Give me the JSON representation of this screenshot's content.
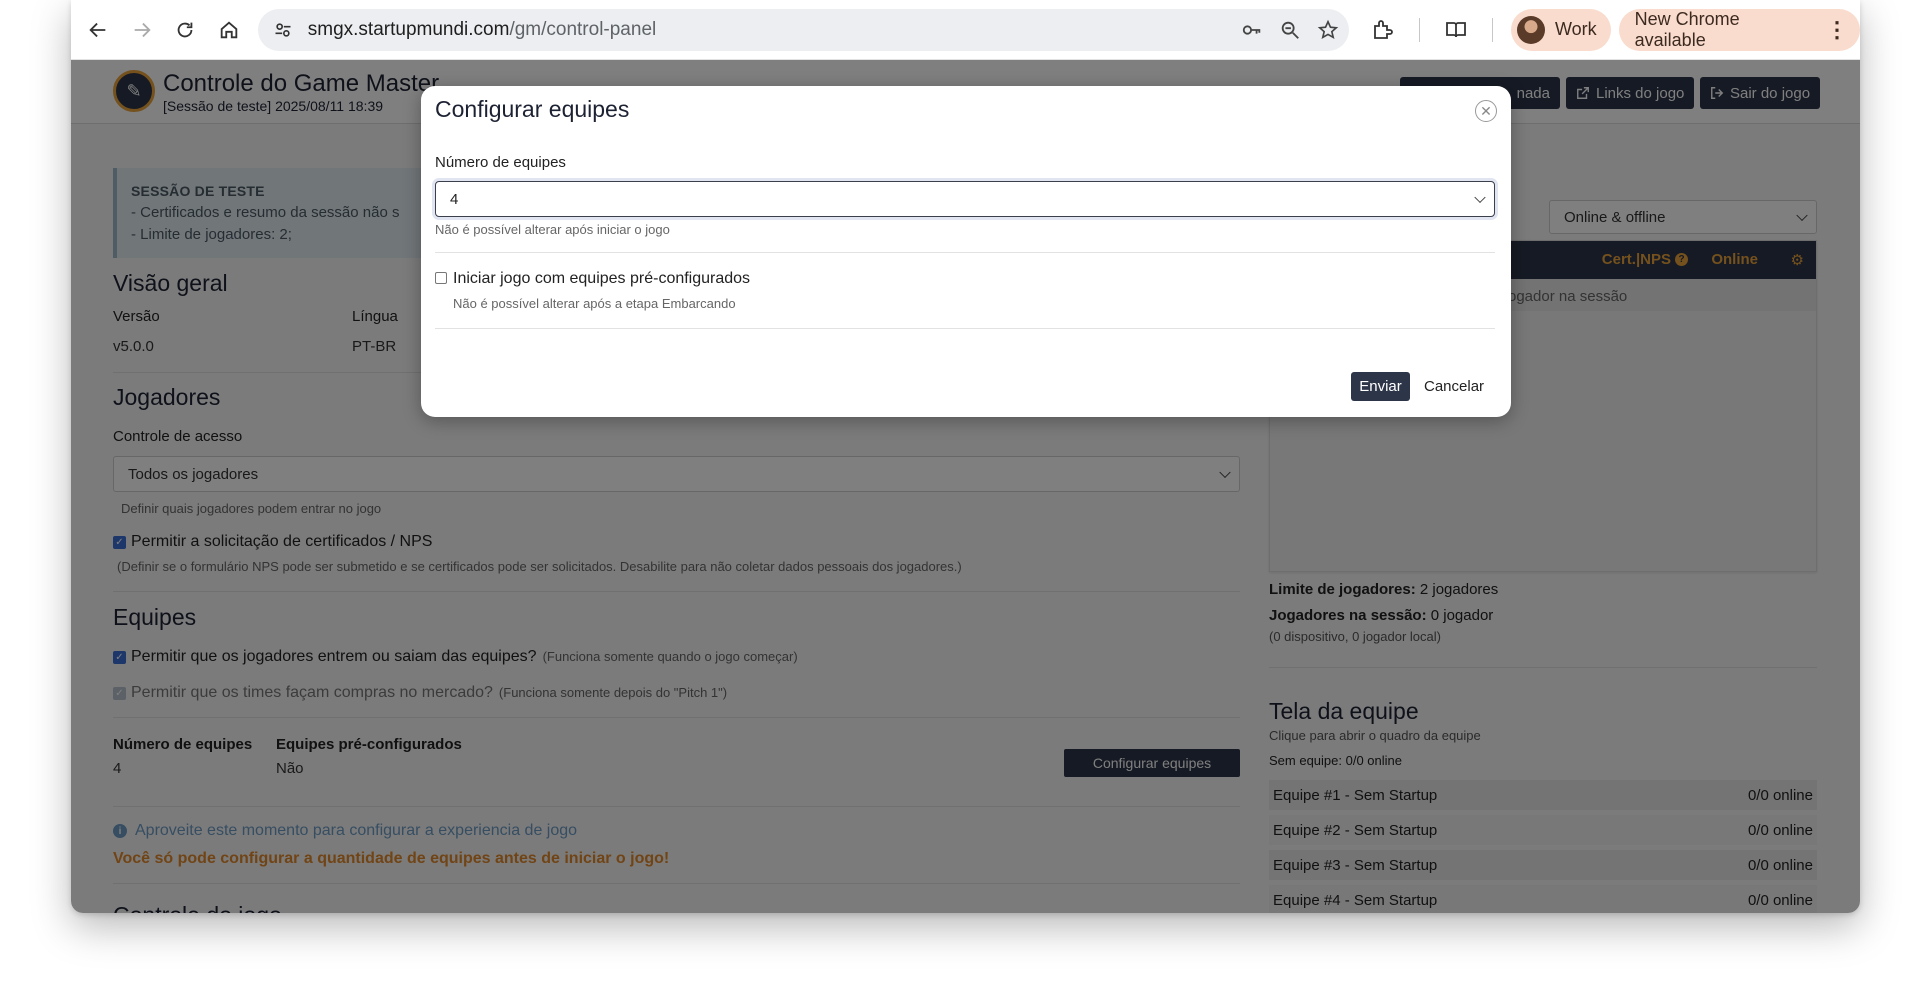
{
  "browser": {
    "url_host": "smgx.startupmundi.com",
    "url_path": "/gm/control-panel",
    "profile_label": "Work",
    "update_label": "New Chrome available"
  },
  "header": {
    "title": "Controle do Game Master",
    "subtitle": "[Sessão de teste] 2025/08/11 18:39",
    "btn_session_partial": "nada",
    "btn_links": "Links do jogo",
    "btn_exit": "Sair do jogo"
  },
  "notice": {
    "title": "SESSÃO DE TESTE",
    "line1": "- Certificados e resumo da sessão não s",
    "line2": "- Limite de jogadores: 2;"
  },
  "overview": {
    "heading": "Visão geral",
    "version_label": "Versão",
    "version_value": "v5.0.0",
    "language_label": "Língua",
    "language_value": "PT-BR"
  },
  "players": {
    "heading": "Jogadores",
    "access_label": "Controle de acesso",
    "access_value": "Todos os jogadores",
    "access_hint": "Definir quais jogadores podem entrar no jogo",
    "nps_label": "Permitir a solicitação de certificados / NPS",
    "nps_hint": "(Definir se o formulário NPS pode ser submetido e se certificados pode ser solicitados. Desabilite para não coletar dados pessoais dos jogadores.)"
  },
  "teams": {
    "heading": "Equipes",
    "allow_join_label": "Permitir que os jogadores entrem ou saiam das equipes?",
    "allow_join_note": "(Funciona somente quando o jogo começar)",
    "allow_buy_label": "Permitir que os times façam compras no mercado?",
    "allow_buy_note": "(Funciona somente depois do \"Pitch 1\")",
    "num_label": "Número de equipes",
    "num_value": "4",
    "preconf_label": "Equipes pré-configurados",
    "preconf_value": "Não",
    "configure_button": "Configurar equipes",
    "info_text": "Aproveite este momento para configurar a experiencia de jogo",
    "warn_text": "Você só pode configurar a quantidade de equipes antes de iniciar o jogo!",
    "partial_heading": "Controle do jogo"
  },
  "right": {
    "filter_value": "Online & offline",
    "col_cert": "Cert.|NPS",
    "col_online": "Online",
    "empty_text": "ogador na sessão",
    "limit_label": "Limite de jogadores:",
    "limit_value": "2 jogadores",
    "in_session_label": "Jogadores na sessão:",
    "in_session_value": "0 jogador",
    "devices": "(0 dispositivo, 0 jogador local)",
    "team_screen_heading": "Tela da equipe",
    "team_screen_hint": "Clique para abrir o quadro da equipe",
    "no_team": "Sem equipe:  0/0 online",
    "team_rows": [
      {
        "name": "Equipe #1 - Sem Startup",
        "status": "0/0 online"
      },
      {
        "name": "Equipe #2 - Sem Startup",
        "status": "0/0 online"
      },
      {
        "name": "Equipe #3 - Sem Startup",
        "status": "0/0 online"
      },
      {
        "name": "Equipe #4 - Sem Startup",
        "status": "0/0 online"
      }
    ]
  },
  "modal": {
    "title": "Configurar equipes",
    "num_label": "Número de equipes",
    "num_value": "4",
    "num_hint": "Não é possível alterar após iniciar o jogo",
    "preconf_label": "Iniciar jogo com equipes pré-configurados",
    "preconf_hint": "Não é possível alterar após a etapa Embarcando",
    "send_label": "Enviar",
    "cancel_label": "Cancelar"
  }
}
